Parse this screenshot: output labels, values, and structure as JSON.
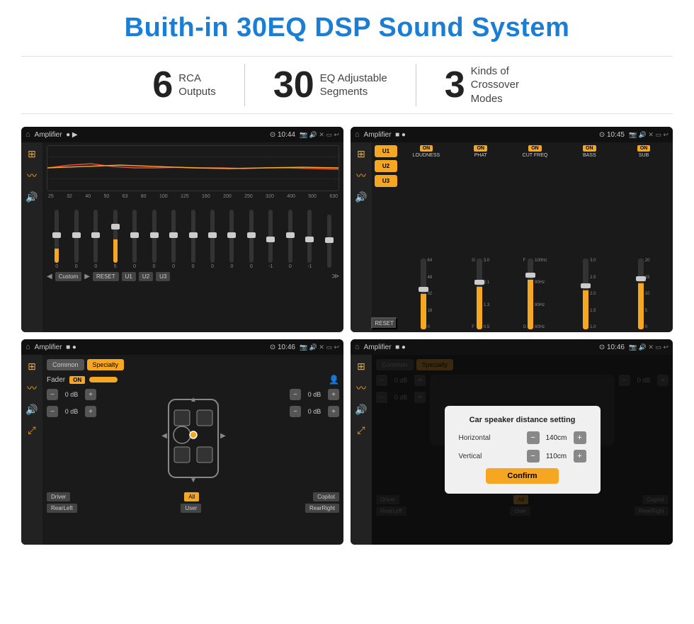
{
  "page": {
    "title": "Buith-in 30EQ DSP Sound System"
  },
  "stats": [
    {
      "number": "6",
      "label": "RCA\nOutputs"
    },
    {
      "number": "30",
      "label": "EQ Adjustable\nSegments"
    },
    {
      "number": "3",
      "label": "Kinds of\nCrossover Modes"
    }
  ],
  "panels": {
    "top_left": {
      "status_title": "Amplifier",
      "time": "10:44",
      "eq_freqs": [
        "25",
        "32",
        "40",
        "50",
        "63",
        "80",
        "100",
        "125",
        "160",
        "200",
        "250",
        "320",
        "400",
        "500",
        "630"
      ],
      "eq_values": [
        "0",
        "0",
        "0",
        "5",
        "0",
        "0",
        "0",
        "0",
        "0",
        "0",
        "0",
        "-1",
        "0",
        "-1",
        ""
      ],
      "preset_label": "Custom",
      "buttons": [
        "RESET",
        "U1",
        "U2",
        "U3"
      ]
    },
    "top_right": {
      "status_title": "Amplifier",
      "time": "10:45",
      "presets": [
        "U1",
        "U2",
        "U3"
      ],
      "channels": [
        {
          "on": true,
          "name": "LOUDNESS"
        },
        {
          "on": true,
          "name": "PHAT"
        },
        {
          "on": true,
          "name": "CUT FREQ"
        },
        {
          "on": true,
          "name": "BASS"
        },
        {
          "on": true,
          "name": "SUB"
        }
      ],
      "reset_label": "RESET"
    },
    "bottom_left": {
      "status_title": "Amplifier",
      "time": "10:46",
      "tabs": [
        "Common",
        "Specialty"
      ],
      "active_tab": "Specialty",
      "fader_label": "Fader",
      "fader_on": "ON",
      "db_values": [
        "0 dB",
        "0 dB",
        "0 dB",
        "0 dB"
      ],
      "buttons": [
        "Driver",
        "All",
        "Copilot",
        "RearLeft",
        "User",
        "RearRight"
      ]
    },
    "bottom_right": {
      "status_title": "Amplifier",
      "time": "10:46",
      "tabs": [
        "Common",
        "Specialty"
      ],
      "modal": {
        "title": "Car speaker distance setting",
        "horizontal_label": "Horizontal",
        "horizontal_value": "140cm",
        "vertical_label": "Vertical",
        "vertical_value": "110cm",
        "confirm_label": "Confirm"
      },
      "db_values": [
        "0 dB",
        "0 dB"
      ],
      "buttons": [
        "Driver",
        "All",
        "Copilot",
        "RearLeft",
        "User",
        "RearRight"
      ]
    }
  }
}
